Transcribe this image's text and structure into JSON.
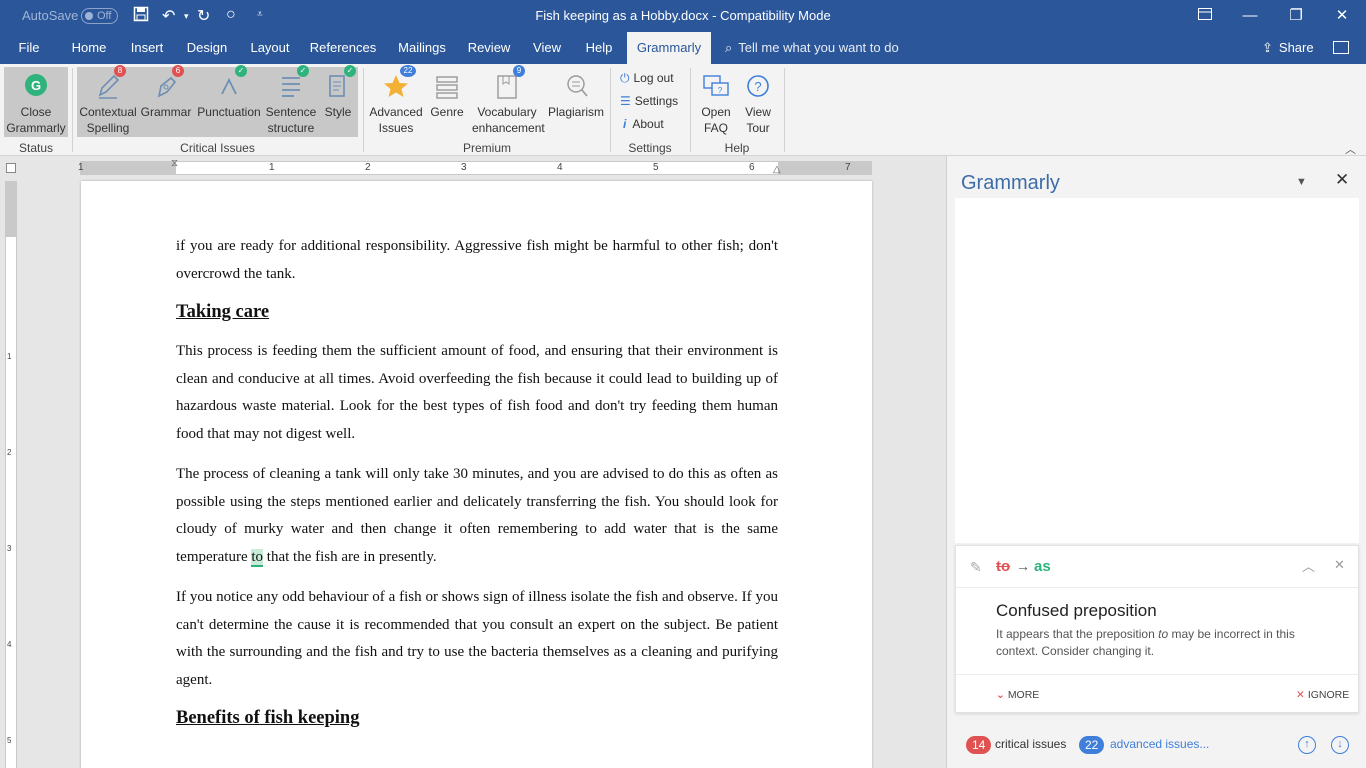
{
  "titlebar": {
    "autosave_label": "AutoSave",
    "autosave_state": "Off",
    "doc_title": "Fish keeping as a Hobby.docx",
    "separator": "-",
    "mode": "Compatibility Mode"
  },
  "tabs": [
    "File",
    "Home",
    "Insert",
    "Design",
    "Layout",
    "References",
    "Mailings",
    "Review",
    "View",
    "Help",
    "Grammarly"
  ],
  "active_tab": "Grammarly",
  "tell_me": "Tell me what you want to do",
  "share_label": "Share",
  "ribbon": {
    "close": [
      "Close",
      "Grammarly"
    ],
    "status_group": "Status",
    "critical": {
      "label": "Critical Issues",
      "items": [
        {
          "line1": "Contextual",
          "line2": "Spelling",
          "badge": "8"
        },
        {
          "line1": "Grammar",
          "line2": "",
          "badge": "6"
        },
        {
          "line1": "Punctuation",
          "line2": "",
          "badge": "✓"
        },
        {
          "line1": "Sentence",
          "line2": "structure",
          "badge": "✓"
        },
        {
          "line1": "Style",
          "line2": "",
          "badge": "✓"
        }
      ]
    },
    "premium": {
      "label": "Premium",
      "items": [
        {
          "line1": "Advanced",
          "line2": "Issues",
          "badge": "22"
        },
        {
          "line1": "Genre",
          "line2": ""
        },
        {
          "line1": "Vocabulary",
          "line2": "enhancement",
          "badge": "9"
        },
        {
          "line1": "Plagiarism",
          "line2": ""
        }
      ]
    },
    "settings": {
      "label": "Settings",
      "items": [
        "Log out",
        "Settings",
        "About"
      ]
    },
    "help": {
      "label": "Help",
      "items": [
        {
          "line1": "Open",
          "line2": "FAQ"
        },
        {
          "line1": "View",
          "line2": "Tour"
        }
      ]
    }
  },
  "ruler": {
    "h_numbers": [
      "1",
      "1",
      "2",
      "3",
      "4",
      "5",
      "6",
      "7"
    ],
    "v_numbers": [
      "1",
      "2",
      "3",
      "4",
      "5"
    ]
  },
  "document": {
    "p1": "if you are ready for additional responsibility. Aggressive fish might be harmful to other fish; don't overcrowd the tank.",
    "h1": "Taking care",
    "p2": "This process is feeding them the sufficient amount of food, and ensuring that their environment is clean and conducive at all times. Avoid overfeeding the fish because it could lead to building up of hazardous waste material. Look for the best types of fish food and don't try feeding them human food that may not digest well.",
    "p3_before": "The process of cleaning a tank will only take 30 minutes, and you are advised to do this as often as possible using the steps mentioned earlier and delicately transferring the fish. You should look for cloudy of murky water and then change it often remembering to add water that is the same temperature ",
    "p3_highlight": "to",
    "p3_after": " that the fish are in presently.",
    "p4": "If you notice any odd behaviour of a fish or shows sign of illness isolate the fish and observe. If you can't determine the cause it is recommended that you consult an expert on the subject. Be patient with the surrounding and the fish and try to use the bacteria themselves as a cleaning and purifying agent.",
    "h2": "Benefits of fish keeping"
  },
  "grammarly_pane": {
    "title": "Grammarly",
    "card": {
      "original": "to",
      "arrow": "→",
      "replacement": "as",
      "title": "Confused preposition",
      "desc_before": "It appears that the preposition ",
      "desc_word": "to",
      "desc_after": " may be incorrect in this context. Consider changing it.",
      "more": "MORE",
      "ignore": "IGNORE"
    },
    "status": {
      "critical_count": "14",
      "critical_label": "critical issues",
      "advanced_count": "22",
      "advanced_label": "advanced issues..."
    }
  },
  "colors": {
    "word_blue": "#2b579a",
    "grammarly_green": "#2fb37c",
    "alert_red": "#e05252",
    "link_blue": "#3f7fd9"
  }
}
